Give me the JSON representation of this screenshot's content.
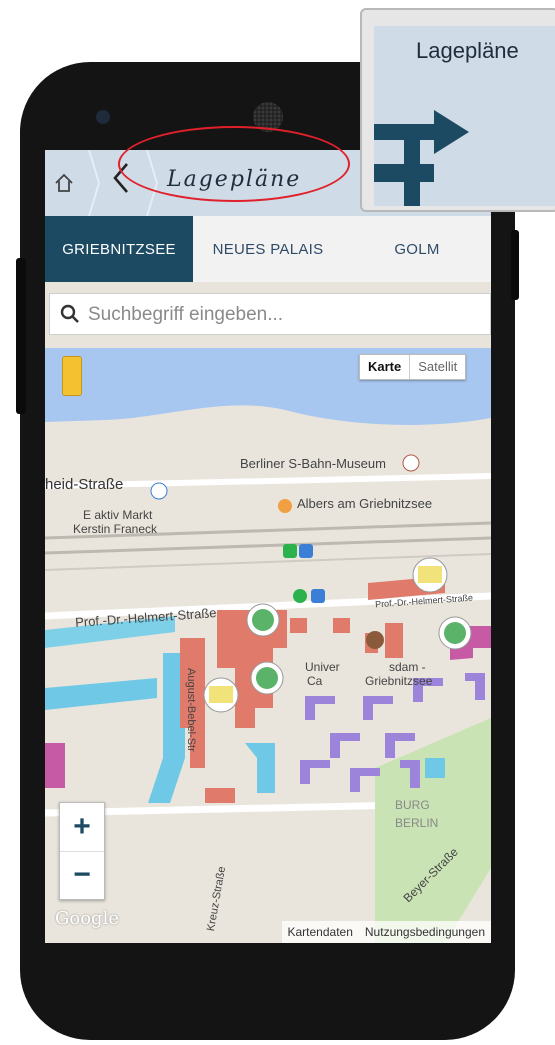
{
  "header": {
    "title": "Lagepläne",
    "home_icon": "home-icon",
    "back_icon": "chevron-left-icon"
  },
  "tabs": [
    {
      "label": "GRIEBNITZSEE",
      "active": true
    },
    {
      "label": "NEUES PALAIS",
      "active": false
    },
    {
      "label": "GOLM",
      "active": false
    }
  ],
  "search": {
    "placeholder": "Suchbegriff eingeben..."
  },
  "map": {
    "type_buttons": {
      "map": "Karte",
      "satellite": "Satellit"
    },
    "zoom_in": "+",
    "zoom_out": "−",
    "google_logo": "Google",
    "attribution": {
      "data": "Kartendaten",
      "terms": "Nutzungsbedingungen"
    },
    "labels": {
      "museum": "Berliner S-Bahn-Museum",
      "street1": "heid-Straße",
      "market1": "E aktiv Markt",
      "market2": "Kerstin Franeck",
      "restaurant": "Albers am Griebnitzsee",
      "street2": "Prof.-Dr.-Helmert-Straße",
      "street2b": "Prof.-Dr.-Helmert-Straße",
      "uni1": "Univer",
      "uni2": "sdam -",
      "campus1": "Ca",
      "campus2": "Griebnitzsee",
      "street3": "August-Bebel-Str",
      "street4": "Kreuz-Straße",
      "street5": "Beyer-Straße",
      "burg": "BURG",
      "berlin": "BERLIN"
    }
  },
  "callout": {
    "title": "Lagepläne",
    "icon": "signpost-icon"
  },
  "colors": {
    "accent": "#1c4a63",
    "appbar": "#cfdbe6",
    "highlight": "#e0202a"
  }
}
